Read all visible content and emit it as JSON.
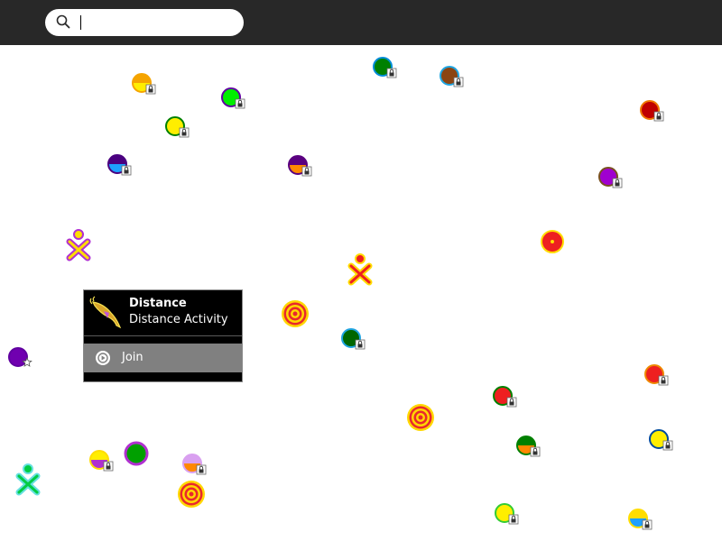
{
  "search": {
    "value": "",
    "placeholder": ""
  },
  "palette": {
    "activity_icon": "distance-dolphin-icon",
    "title": "Distance",
    "subtitle": "Distance Activity",
    "join_label": "Join",
    "join_icon": "play-circle-icon"
  },
  "colors": {
    "toolbar": "#282828",
    "palette_background": "#000000",
    "palette_join_background": "#808080"
  },
  "mesh_legend": {
    "buddy": "xo-buddy-icon",
    "access_point_locked": "locked-access-point-icon",
    "access_point_favorite": "favorite-access-point-icon",
    "mesh_channel": "mesh-channel-target-icon",
    "activity": "distance-activity-icon"
  }
}
